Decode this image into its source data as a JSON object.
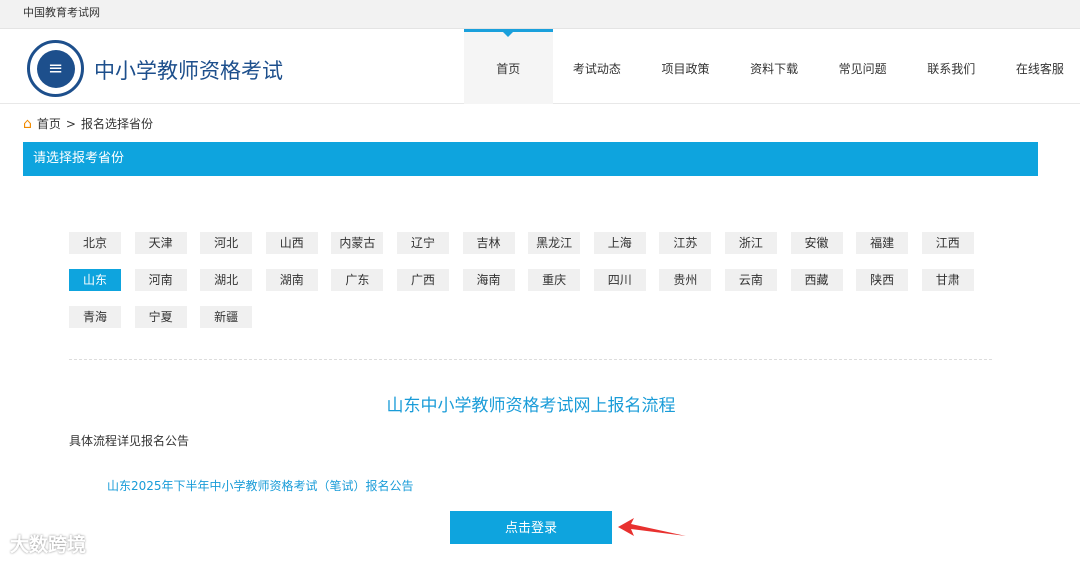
{
  "topbar": {
    "text": "中国教育考试网"
  },
  "header": {
    "site_name": "中小学教师资格考试"
  },
  "nav": [
    "首页",
    "考试动态",
    "项目政策",
    "资料下载",
    "常见问题",
    "联系我们",
    "在线客服"
  ],
  "breadcrumb": {
    "home": "首页",
    "sep": ">",
    "current": "报名选择省份"
  },
  "panel_title": "请选择报考省份",
  "provinces": [
    "北京",
    "天津",
    "河北",
    "山西",
    "内蒙古",
    "辽宁",
    "吉林",
    "黑龙江",
    "上海",
    "江苏",
    "浙江",
    "安徽",
    "福建",
    "江西",
    "山东",
    "河南",
    "湖北",
    "湖南",
    "广东",
    "广西",
    "海南",
    "重庆",
    "四川",
    "贵州",
    "云南",
    "西藏",
    "陕西",
    "甘肃",
    "青海",
    "宁夏",
    "新疆"
  ],
  "selected_province": "山东",
  "flow": {
    "title": "山东中小学教师资格考试网上报名流程",
    "detail": "具体流程详见报名公告",
    "notice_link": "山东2025年下半年中小学教师资格考试（笔试）报名公告",
    "login_button": "点击登录"
  },
  "watermark": "大数跨境",
  "colors": {
    "accent": "#0ea4de",
    "brand": "#1d4f8c",
    "arrow": "#e8312f"
  }
}
